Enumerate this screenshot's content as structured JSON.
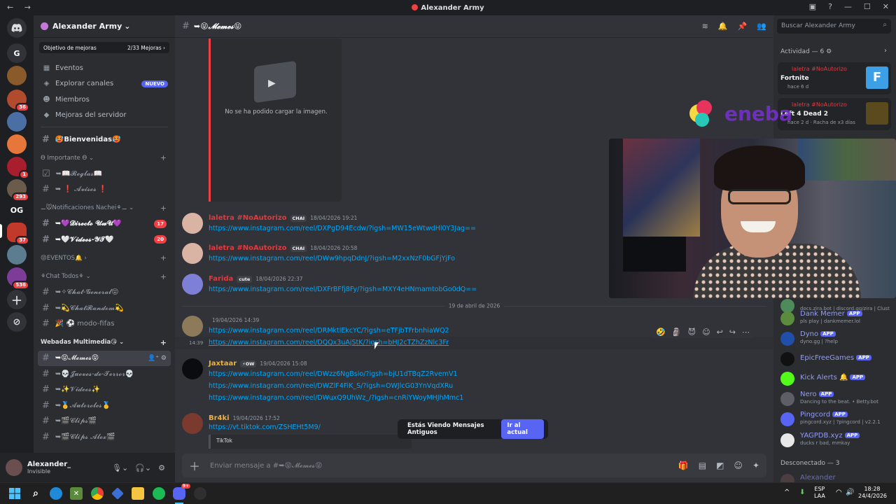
{
  "window": {
    "title": "Alexander Army",
    "nav_back": "←",
    "nav_fwd": "→"
  },
  "rail": {
    "home_icon": "discord-icon",
    "letters": [
      "G",
      "OG"
    ],
    "badges": [
      "36",
      "1",
      "293",
      "37",
      "536"
    ]
  },
  "server": {
    "name": "Alexander Army",
    "boost_goal": "Objetivo de mejoras",
    "boost_progress": "2/33 Mejoras",
    "nav": [
      {
        "label": "Eventos",
        "icon": "calendar-icon"
      },
      {
        "label": "Explorar canales",
        "icon": "compass-icon",
        "badge": "NUEVO"
      },
      {
        "label": "Miembros",
        "icon": "members-icon"
      },
      {
        "label": "Mejoras del servidor",
        "icon": "boost-icon"
      }
    ],
    "welcome": "🥵Bienvenidas🥵",
    "categories": [
      {
        "name": "ϴ Importante ϴ"
      },
      {
        "name": "⚊🐭Notificaciones Nachei⚘⚊"
      },
      {
        "name": "😝EVENTOS🔔"
      },
      {
        "name": "⚘Chat Todos⚘"
      },
      {
        "name": "Webadas Multimedia😘"
      }
    ],
    "channels": {
      "reglas": "➥📖𝓡𝓮𝓰𝓵𝓪𝓼📖",
      "avisos": "➥ ❗ 𝓐𝓿𝓲𝓼𝓸𝓼 ❗",
      "directo": "➥💜𝓓𝓲𝓻𝓮𝓬𝓽𝓸 𝓤𝔀𝓤💜",
      "directo_count": "17",
      "videos_yt": "➥🤍𝓥𝓲𝓭𝓮𝓸𝓼-𝓨𝓣🤍",
      "videos_yt_count": "20",
      "chat_general": "➥✧𝓒𝓱𝓪𝓽-𝓖𝓮𝓷𝓮𝓻𝓪𝓵😝",
      "chat_random": "➥💫𝓒𝓱𝓪𝓽𝓡𝓪𝓷𝓭𝓸𝓶💫",
      "modo_fifas": "🎉 ⚽ modo-fifas",
      "memes": "➥😝𝓜𝓮𝓶𝓮𝓼😝",
      "jueves": "➥💀𝓙𝓾𝓮𝓿𝓮𝓼-𝓭𝓮-𝓣𝓮𝓻𝓻𝓸𝓻💀",
      "videos": "➥✨𝓥𝓲𝓭𝓮𝓸𝓼✨",
      "autoroles": "➥🥇𝓐𝓾𝓽𝓸𝓻𝓸𝓵𝓮𝓼🥇",
      "clips": "➥🎬𝓒𝓵𝓲𝓹𝓼🎬",
      "clips2": "➥🎬𝓒𝓵𝓲𝓹𝓼 𝓐𝓵𝓮𝔁🎬"
    }
  },
  "user": {
    "name": "Alexander_",
    "status": "Invisible"
  },
  "channel": {
    "title": "➥😝𝓜𝓮𝓶𝓮𝓼😝",
    "composer_placeholder": "Enviar mensaje a #➥😝𝓜𝓮𝓶𝓮𝓼😝",
    "image_error": "No se ha podido cargar la imagen."
  },
  "messages": [
    {
      "author": "laletra #NoAutorizo",
      "tag": "CHAI",
      "time": "18/04/2026 19:21",
      "link": "https://www.instagram.com/reel/DXPgD94Ecdw/?igsh=MW15eWtwdHl0Y3Jag=="
    },
    {
      "author": "laletra #NoAutorizo",
      "tag": "CHAI",
      "time": "18/04/2026 20:58",
      "link": "https://www.instagram.com/reel/DWw9hpqDdnJ/?igsh=M2xxNzF0bGFjYjFo"
    },
    {
      "author": "Farida",
      "tag": "cute",
      "time": "18/04/2026 22:37",
      "link": "https://www.instagram.com/reel/DXFrBFfj8Fy/?igsh=MXY4eHNmamtobGo0dQ=="
    },
    {
      "author": "",
      "time": "19/04/2026 14:39",
      "link": "https://www.instagram.com/reel/DRMktlEkcYC/?igsh=eTFjbTFrbnhiaWQ2",
      "link2": "https://www.instagram.com/reel/DQQx3uAjStK/?igsh=bHJ2cTZhZzNlc3Fr",
      "link2_time": "14:39"
    },
    {
      "author": "Jaxtaar",
      "tag": "OW",
      "time": "19/04/2026 15:08",
      "links": [
        "https://www.instagram.com/reel/DWzz6NgBsio/?igsh=bjU1dTBqZ2RvemV1",
        "https://www.instagram.com/reel/DWZlF4FiK_S/?igsh=OWJlcG03YnVqdXRu",
        "https://www.instagram.com/reel/DWuxQ9UhWz_/?igsh=cnRiYWoyMHJhMmc1"
      ]
    },
    {
      "author": "Br4ki",
      "time": "19/04/2026 17:52",
      "link": "https://vt.tiktok.com/ZSHEHt5M9/",
      "embed": "TikTok"
    }
  ],
  "date_divider": "19 de abril de 2026",
  "old_messages": {
    "label": "Estás Viendo Mensajes Antiguos",
    "button": "Ir al actual"
  },
  "members_panel": {
    "search_placeholder": "Buscar Alexander Army",
    "activity_title": "Actividad — 6",
    "activities": [
      {
        "user": "laletra #NoAutorizo",
        "game": "Fortnite",
        "when": "hace 6 d"
      },
      {
        "user": "laletra #NoAutorizo",
        "game": "Left 4 Dead 2",
        "when": "hace 2 d",
        "streak": "Racha de x3 días"
      }
    ],
    "bots": [
      {
        "name": "",
        "sub": "docs.zira.bot | discord.gg/zira | Clust"
      },
      {
        "name": "Dank Memer",
        "sub": "pls play | dankmemer.lol"
      },
      {
        "name": "Dyno",
        "sub": "dyno.gg | ?help"
      },
      {
        "name": "EpicFreeGames",
        "sub": ""
      },
      {
        "name": "Kick Alerts",
        "sub": ""
      },
      {
        "name": "Nero",
        "sub": "Dancing to the beat. • Betty.bot"
      },
      {
        "name": "Pingcord",
        "sub": "pingcord.xyz | ?pingcord | v2.2.1"
      },
      {
        "name": "YAGPDB.xyz",
        "sub": "ducks r bad, mmkay"
      }
    ],
    "app_label": "APP",
    "offline_title": "Desconectado — 3",
    "offline_first": "Alexander"
  },
  "overlay": {
    "brand": "eneba"
  },
  "taskbar": {
    "lang1": "ESP",
    "lang2": "LAA",
    "time": "18:28",
    "date": "24/4/2026",
    "discord_badge": "9+"
  }
}
